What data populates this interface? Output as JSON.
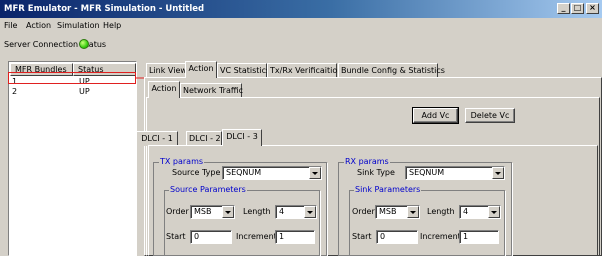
{
  "window": {
    "title": "MFR Emulator - MFR Simulation - Untitled",
    "buttons": {
      "minimize": "_",
      "maximize": "□",
      "close": "×"
    }
  },
  "menu": [
    {
      "label": "File"
    },
    {
      "label": "Action"
    },
    {
      "label": "Simulation"
    },
    {
      "label": "Help"
    }
  ],
  "server_status": {
    "label": "Server Connection Status",
    "state_color": "#3bcf12"
  },
  "bundles": {
    "columns": [
      "MFR Bundles",
      "Status"
    ],
    "rows": [
      {
        "id": "1",
        "status": "UP"
      },
      {
        "id": "2",
        "status": "UP"
      }
    ],
    "highlight_color": "#e02020"
  },
  "main_tabs": [
    "Link View",
    "Action",
    "VC Statistics",
    "Tx/Rx Verificaition",
    "Bundle Config & Statistics"
  ],
  "sub_tabs": [
    "Action",
    "Network Traffic"
  ],
  "buttons": {
    "add_vc": "Add Vc",
    "delete_vc": "Delete Vc"
  },
  "dlci_tabs": [
    "DLCI - 1",
    "DLCI - 2",
    "DLCI - 3"
  ],
  "tx": {
    "title": "TX params",
    "source_type_label": "Source Type",
    "source_type_value": "SEQNUM",
    "source_params_title": "Source Parameters",
    "order_label": "Order",
    "order_value": "MSB",
    "length_label": "Length",
    "length_value": "4",
    "start_label": "Start",
    "start_value": "0",
    "increment_label": "Increment",
    "increment_value": "1"
  },
  "rx": {
    "title": "RX params",
    "sink_type_label": "Sink Type",
    "sink_type_value": "SEQNUM",
    "sink_params_title": "Sink Parameters",
    "order_label": "Order",
    "order_value": "MSB",
    "length_label": "Length",
    "length_value": "4",
    "start_label": "Start",
    "start_value": "0",
    "increment_label": "Increment",
    "increment_value": "1"
  },
  "colors": {
    "annotation_red": "#e02020",
    "group_title_blue": "#0000cc"
  }
}
